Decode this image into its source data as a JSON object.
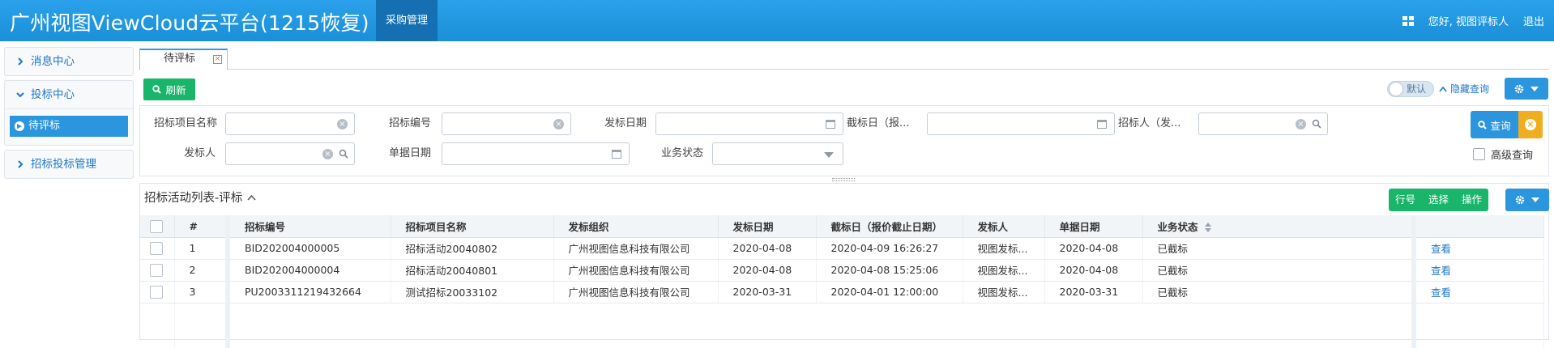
{
  "header": {
    "app_title": "广州视图ViewCloud云平台(1215恢复)",
    "active_nav": "采购管理",
    "greeting": "您好, 视图评标人",
    "logout": "退出"
  },
  "sidebar": {
    "groups": [
      {
        "label": "消息中心"
      },
      {
        "label": "投标中心",
        "items": [
          {
            "label": "待评标"
          }
        ]
      },
      {
        "label": "招标投标管理"
      }
    ]
  },
  "tabs": [
    {
      "label": "待评标"
    }
  ],
  "toolbar": {
    "refresh": "刷新",
    "toggle_label": "默认",
    "hide_query": "隐藏查询"
  },
  "query": {
    "project_name": "招标项目名称",
    "bid_no": "招标编号",
    "issue_date": "发标日期",
    "deadline": "截标日（报...",
    "tenderer": "招标人（发...",
    "issuer": "发标人",
    "doc_date": "单据日期",
    "biz_status": "业务状态",
    "search_btn": "查询",
    "advanced": "高级查询"
  },
  "table": {
    "title": "招标活动列表-评标",
    "actions": [
      "行号",
      "选择",
      "操作"
    ],
    "columns": [
      "#",
      "招标编号",
      "招标项目名称",
      "发标组织",
      "发标日期",
      "截标日（报价截止日期）",
      "发标人",
      "单据日期",
      "业务状态"
    ],
    "rows": [
      {
        "no": "1",
        "bid_no": "BID202004000005",
        "name": "招标活动20040802",
        "org": "广州视图信息科技有限公司",
        "issue_date": "2020-04-08",
        "deadline": "2020-04-09 16:26:27",
        "issuer": "视图发标...",
        "doc_date": "2020-04-08",
        "status": "已截标",
        "op": "查看"
      },
      {
        "no": "2",
        "bid_no": "BID202004000004",
        "name": "招标活动20040801",
        "org": "广州视图信息科技有限公司",
        "issue_date": "2020-04-08",
        "deadline": "2020-04-08 15:25:06",
        "issuer": "视图发标...",
        "doc_date": "2020-04-08",
        "status": "已截标",
        "op": "查看"
      },
      {
        "no": "3",
        "bid_no": "PU2003311219432664",
        "name": "测试招标20033102",
        "org": "广州视图信息科技有限公司",
        "issue_date": "2020-03-31",
        "deadline": "2020-04-01 12:00:00",
        "issuer": "视图发标...",
        "doc_date": "2020-03-31",
        "status": "已截标",
        "op": "查看"
      }
    ]
  },
  "colors": {
    "primary": "#2b95dd",
    "header": "#1b8fd8",
    "success": "#19b56a",
    "warning": "#f0ad1f"
  }
}
